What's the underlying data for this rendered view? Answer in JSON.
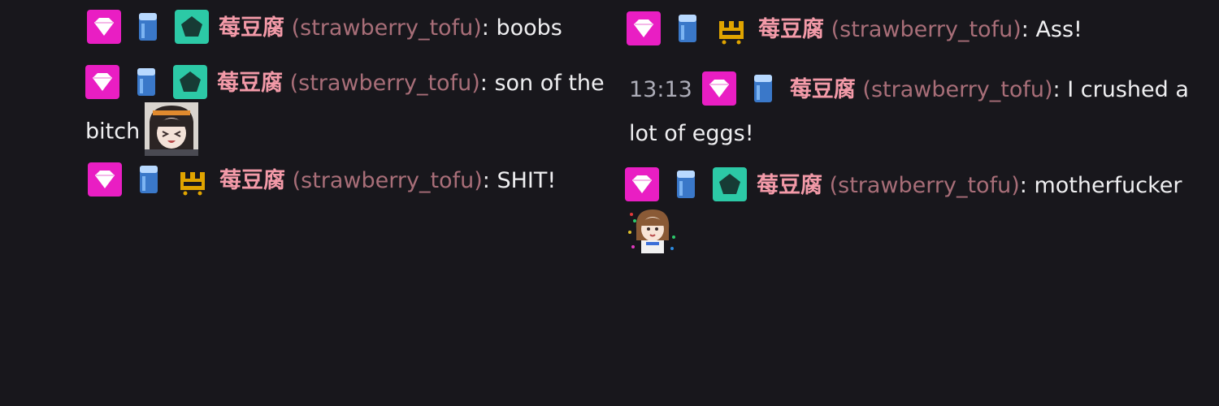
{
  "colors": {
    "background": "#18171c",
    "username": "#f39aa8",
    "login": "#a86e78",
    "text": "#efeff1",
    "timestamp": "#adadb8",
    "badge_pink": "#e91ec3",
    "badge_teal": "#2cc9a6",
    "badge_gold": "#e0a400",
    "badge_cup": "#4b8fe0"
  },
  "badges": {
    "subscriber": "pink-heart-gem-icon",
    "cup": "blue-cup-icon",
    "teal": "teal-pentagon-icon",
    "gold": "gold-crown-icon"
  },
  "messages": [
    {
      "display_name": "莓豆腐",
      "login": "(strawberry_tofu)",
      "colon": ":",
      "text": "boobs",
      "timestamp": "",
      "badges": [
        "pink-heart-gem-icon",
        "blue-cup-icon",
        "teal-pentagon-icon"
      ]
    },
    {
      "display_name": "莓豆腐",
      "login": "(strawberry_tofu)",
      "colon": ":",
      "text": "son of the bitch",
      "timestamp": "",
      "badges": [
        "pink-heart-gem-icon",
        "blue-cup-icon",
        "teal-pentagon-icon"
      ],
      "emote": "anime-girl-laughing-emote"
    },
    {
      "display_name": "莓豆腐",
      "login": "(strawberry_tofu)",
      "colon": ":",
      "text": "SHIT!",
      "timestamp": "",
      "badges": [
        "pink-heart-gem-icon",
        "blue-cup-icon",
        "gold-crown-icon"
      ]
    },
    {
      "display_name": "莓豆腐",
      "login": "(strawberry_tofu)",
      "colon": ":",
      "text": "Ass!",
      "timestamp": "",
      "badges": [
        "pink-heart-gem-icon",
        "blue-cup-icon",
        "gold-crown-icon"
      ]
    },
    {
      "display_name": "莓豆腐",
      "login": "(strawberry_tofu)",
      "colon": ":",
      "text": "I crushed a lot of eggs!",
      "timestamp": "13:13",
      "badges": [
        "pink-heart-gem-icon",
        "blue-cup-icon"
      ]
    },
    {
      "display_name": "莓豆腐",
      "login": "(strawberry_tofu)",
      "colon": ":",
      "text": "motherfucker",
      "timestamp": "",
      "badges": [
        "pink-heart-gem-icon",
        "blue-cup-icon",
        "teal-pentagon-icon"
      ],
      "emote": "anime-girl-dancing-emote"
    }
  ]
}
